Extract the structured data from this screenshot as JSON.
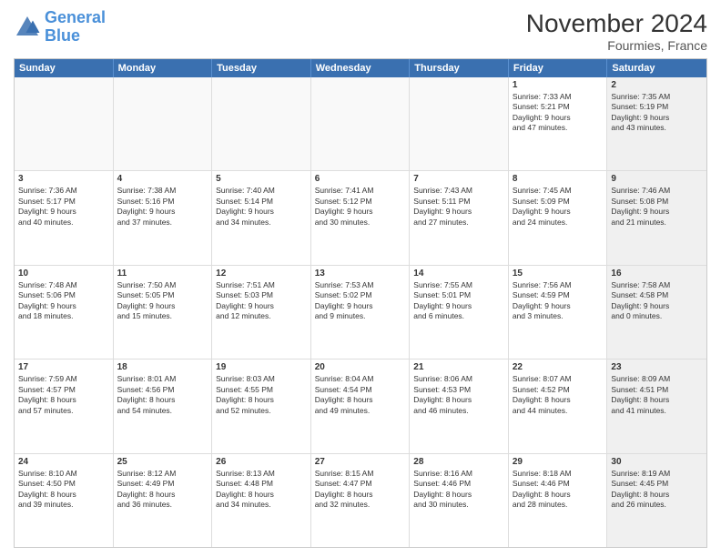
{
  "header": {
    "logo_general": "General",
    "logo_blue": "Blue",
    "month_title": "November 2024",
    "location": "Fourmies, France"
  },
  "days_of_week": [
    "Sunday",
    "Monday",
    "Tuesday",
    "Wednesday",
    "Thursday",
    "Friday",
    "Saturday"
  ],
  "weeks": [
    [
      {
        "day": "",
        "info": "",
        "empty": true
      },
      {
        "day": "",
        "info": "",
        "empty": true
      },
      {
        "day": "",
        "info": "",
        "empty": true
      },
      {
        "day": "",
        "info": "",
        "empty": true
      },
      {
        "day": "",
        "info": "",
        "empty": true
      },
      {
        "day": "1",
        "info": "Sunrise: 7:33 AM\nSunset: 5:21 PM\nDaylight: 9 hours\nand 47 minutes.",
        "empty": false,
        "shaded": false
      },
      {
        "day": "2",
        "info": "Sunrise: 7:35 AM\nSunset: 5:19 PM\nDaylight: 9 hours\nand 43 minutes.",
        "empty": false,
        "shaded": true
      }
    ],
    [
      {
        "day": "3",
        "info": "Sunrise: 7:36 AM\nSunset: 5:17 PM\nDaylight: 9 hours\nand 40 minutes.",
        "empty": false,
        "shaded": false
      },
      {
        "day": "4",
        "info": "Sunrise: 7:38 AM\nSunset: 5:16 PM\nDaylight: 9 hours\nand 37 minutes.",
        "empty": false,
        "shaded": false
      },
      {
        "day": "5",
        "info": "Sunrise: 7:40 AM\nSunset: 5:14 PM\nDaylight: 9 hours\nand 34 minutes.",
        "empty": false,
        "shaded": false
      },
      {
        "day": "6",
        "info": "Sunrise: 7:41 AM\nSunset: 5:12 PM\nDaylight: 9 hours\nand 30 minutes.",
        "empty": false,
        "shaded": false
      },
      {
        "day": "7",
        "info": "Sunrise: 7:43 AM\nSunset: 5:11 PM\nDaylight: 9 hours\nand 27 minutes.",
        "empty": false,
        "shaded": false
      },
      {
        "day": "8",
        "info": "Sunrise: 7:45 AM\nSunset: 5:09 PM\nDaylight: 9 hours\nand 24 minutes.",
        "empty": false,
        "shaded": false
      },
      {
        "day": "9",
        "info": "Sunrise: 7:46 AM\nSunset: 5:08 PM\nDaylight: 9 hours\nand 21 minutes.",
        "empty": false,
        "shaded": true
      }
    ],
    [
      {
        "day": "10",
        "info": "Sunrise: 7:48 AM\nSunset: 5:06 PM\nDaylight: 9 hours\nand 18 minutes.",
        "empty": false,
        "shaded": false
      },
      {
        "day": "11",
        "info": "Sunrise: 7:50 AM\nSunset: 5:05 PM\nDaylight: 9 hours\nand 15 minutes.",
        "empty": false,
        "shaded": false
      },
      {
        "day": "12",
        "info": "Sunrise: 7:51 AM\nSunset: 5:03 PM\nDaylight: 9 hours\nand 12 minutes.",
        "empty": false,
        "shaded": false
      },
      {
        "day": "13",
        "info": "Sunrise: 7:53 AM\nSunset: 5:02 PM\nDaylight: 9 hours\nand 9 minutes.",
        "empty": false,
        "shaded": false
      },
      {
        "day": "14",
        "info": "Sunrise: 7:55 AM\nSunset: 5:01 PM\nDaylight: 9 hours\nand 6 minutes.",
        "empty": false,
        "shaded": false
      },
      {
        "day": "15",
        "info": "Sunrise: 7:56 AM\nSunset: 4:59 PM\nDaylight: 9 hours\nand 3 minutes.",
        "empty": false,
        "shaded": false
      },
      {
        "day": "16",
        "info": "Sunrise: 7:58 AM\nSunset: 4:58 PM\nDaylight: 9 hours\nand 0 minutes.",
        "empty": false,
        "shaded": true
      }
    ],
    [
      {
        "day": "17",
        "info": "Sunrise: 7:59 AM\nSunset: 4:57 PM\nDaylight: 8 hours\nand 57 minutes.",
        "empty": false,
        "shaded": false
      },
      {
        "day": "18",
        "info": "Sunrise: 8:01 AM\nSunset: 4:56 PM\nDaylight: 8 hours\nand 54 minutes.",
        "empty": false,
        "shaded": false
      },
      {
        "day": "19",
        "info": "Sunrise: 8:03 AM\nSunset: 4:55 PM\nDaylight: 8 hours\nand 52 minutes.",
        "empty": false,
        "shaded": false
      },
      {
        "day": "20",
        "info": "Sunrise: 8:04 AM\nSunset: 4:54 PM\nDaylight: 8 hours\nand 49 minutes.",
        "empty": false,
        "shaded": false
      },
      {
        "day": "21",
        "info": "Sunrise: 8:06 AM\nSunset: 4:53 PM\nDaylight: 8 hours\nand 46 minutes.",
        "empty": false,
        "shaded": false
      },
      {
        "day": "22",
        "info": "Sunrise: 8:07 AM\nSunset: 4:52 PM\nDaylight: 8 hours\nand 44 minutes.",
        "empty": false,
        "shaded": false
      },
      {
        "day": "23",
        "info": "Sunrise: 8:09 AM\nSunset: 4:51 PM\nDaylight: 8 hours\nand 41 minutes.",
        "empty": false,
        "shaded": true
      }
    ],
    [
      {
        "day": "24",
        "info": "Sunrise: 8:10 AM\nSunset: 4:50 PM\nDaylight: 8 hours\nand 39 minutes.",
        "empty": false,
        "shaded": false
      },
      {
        "day": "25",
        "info": "Sunrise: 8:12 AM\nSunset: 4:49 PM\nDaylight: 8 hours\nand 36 minutes.",
        "empty": false,
        "shaded": false
      },
      {
        "day": "26",
        "info": "Sunrise: 8:13 AM\nSunset: 4:48 PM\nDaylight: 8 hours\nand 34 minutes.",
        "empty": false,
        "shaded": false
      },
      {
        "day": "27",
        "info": "Sunrise: 8:15 AM\nSunset: 4:47 PM\nDaylight: 8 hours\nand 32 minutes.",
        "empty": false,
        "shaded": false
      },
      {
        "day": "28",
        "info": "Sunrise: 8:16 AM\nSunset: 4:46 PM\nDaylight: 8 hours\nand 30 minutes.",
        "empty": false,
        "shaded": false
      },
      {
        "day": "29",
        "info": "Sunrise: 8:18 AM\nSunset: 4:46 PM\nDaylight: 8 hours\nand 28 minutes.",
        "empty": false,
        "shaded": false
      },
      {
        "day": "30",
        "info": "Sunrise: 8:19 AM\nSunset: 4:45 PM\nDaylight: 8 hours\nand 26 minutes.",
        "empty": false,
        "shaded": true
      }
    ]
  ]
}
